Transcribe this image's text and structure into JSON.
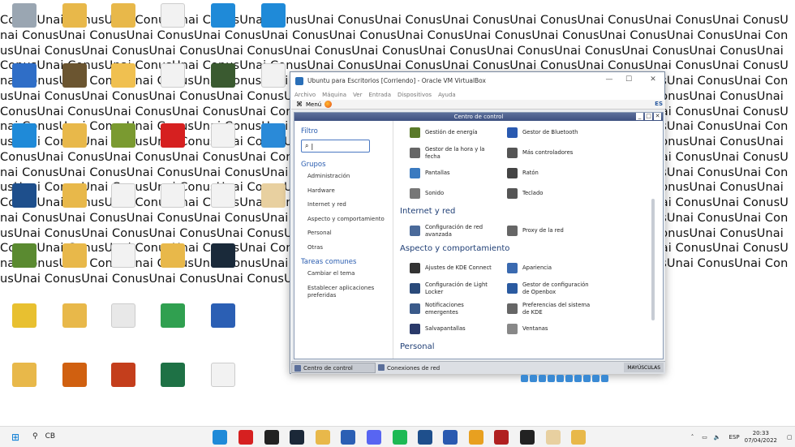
{
  "wallpaper": {
    "text": "ConusUnai ConusUnai ConusUnai ConusUnai ConusUnai ConusUnai ConusUnai ConusUnai ConusUnai ConusUnai ConusUnai ConusUnai ConusUnai ConusUnai ConusUnai ConusUnai ConusUnai ConusUnai ConusUnai ConusUnai ConusUnai ConusUnai ConusUnai ConusUnai ConusUnai ConusUnai ConusUnai ConusUnai ConusUnai ConusUnai ConusUnai ConusUnai ConusUnai ConusUnai ConusUnai ConusUnai ConusUnai ConusUnai ConusUnai ConusUnai ConusUnai ConusUnai ConusUnai ConusUnai ConusUnai ConusUnai ConusUnai ConusUnai ConusUnai ConusUnai ConusUnai ConusUnai ConusUnai ConusUnai ConusUnai ConusUnai ConusUnai ConusUnai ConusUnai ConusUnai ConusUnai ConusUnai ConusUnai ConusUnai ConusUnai ConusUnai ConusUnai ConusUnai ConusUnai ConusUnai ConusUnai ConusUnai ConusUnai ConusUnai ConusUnai ConusUnai ConusUnai ConusUnai ConusUnai ConusUnai ConusUnai ConusUnai ConusUnai ConusUnai ConusUnai ConusUnai ConusUnai ConusUnai ConusUnai ConusUnai ConusUnai ConusUnai ConusUnai ConusUnai ConusUnai ConusUnai ConusUnai ConusUnai ConusUnai ConusUnai ConusUnai ConusUnai ConusUnai ConusUnai ConusUnai ConusUnai ConusUnai ConusUnai ConusUnai ConusUnai ConusUnai ConusUnai ConusUnai ConusUnai ConusUnai ConusUnai ConusUnai ConusUnai ConusUnai ConusUnai ConusUnai ConusUnai ConusUnai ConusUnai ConusUnai ConusUnai ConusUnai ConusUnai ConusUnai ConusUnai ConusUnai ConusUnai ConusUnai ConusUnai ConusUnai ConusUnai ConusUnai ConusUnai ConusUnai ConusUnai ConusUnai ConusUnai ConusUnai ConusUnai ConusUnai ConusUnai ConusUnai ConusUnai ConusUnai ConusUnai ConusUnai ConusUnai ConusUnai ConusUnai ConusUnai ConusUnai ConusUnai ConusUnai ConusUnai ConusUnai ConusUnai ConusUnai ConusUnai ConusUnai ConusUnai ConusUnai ConusUnai ConusUnai ConusUnai ConusUnai ConusUnai ConusUnai ConusUnai ConusUnai ConusUnai ConusUnai ConusUnai ConusUnai ConusUnai ConusUnai ConusUnai ConusUnai ConusUnai ConusUnai ConusUnai ConusUnai ConusUnai ConusUnai ConusUnai ConusUnai ConusUnai ConusUnai ConusUnai ConusUnai ConusUnai ConusUnai ConusUnai ConusUnai ConusUnai ConusUnai ConusUnai ConusUnai ConusUnai ConusUnai Conus"
  },
  "desktop_icons": [
    {
      "icon": "recycle-bin-icon",
      "color": "#9aa6b2"
    },
    {
      "icon": "folder-icon",
      "color": "#e8b84a"
    },
    {
      "icon": "folder-icon",
      "color": "#e8b84a"
    },
    {
      "icon": "file-icon",
      "color": "#f2f2f2"
    },
    {
      "icon": "edge-icon",
      "color": "#1f8ad8"
    },
    {
      "icon": "edge-icon",
      "color": "#1f8ad8"
    },
    {
      "icon": "shield-icon",
      "color": "#2f6ec7"
    },
    {
      "icon": "game-icon",
      "color": "#6b5530"
    },
    {
      "icon": "app-icon",
      "color": "#f0c050"
    },
    {
      "icon": "file-icon",
      "color": "#f2f2f2"
    },
    {
      "icon": "game-icon",
      "color": "#3a5a30"
    },
    {
      "icon": "file-icon",
      "color": "#f2f2f2"
    },
    {
      "icon": "edge-icon",
      "color": "#1f8ad8"
    },
    {
      "icon": "folder-icon",
      "color": "#e8b84a"
    },
    {
      "icon": "game-icon",
      "color": "#7a9a30"
    },
    {
      "icon": "opera-icon",
      "color": "#d62020"
    },
    {
      "icon": "file-icon",
      "color": "#f2f2f2"
    },
    {
      "icon": "app-icon",
      "color": "#2a8ad8"
    },
    {
      "icon": "virtualbox-icon",
      "color": "#1e4f8c"
    },
    {
      "icon": "folder-icon",
      "color": "#e8b84a"
    },
    {
      "icon": "file-icon",
      "color": "#f2f2f2"
    },
    {
      "icon": "file-icon",
      "color": "#f2f2f2"
    },
    {
      "icon": "file-icon",
      "color": "#f2f2f2"
    },
    {
      "icon": "game-icon",
      "color": "#e8d0a0"
    },
    {
      "icon": "minecraft-icon",
      "color": "#5a8a30"
    },
    {
      "icon": "folder-icon",
      "color": "#e8b84a"
    },
    {
      "icon": "file-icon",
      "color": "#f2f2f2"
    },
    {
      "icon": "folder-icon",
      "color": "#e8b84a"
    },
    {
      "icon": "filmora-icon",
      "color": "#1a2a3a"
    },
    {
      "icon": "app-icon",
      "color": "#e8c030"
    },
    {
      "icon": "folder-icon",
      "color": "#e8b84a"
    },
    {
      "icon": "file-icon",
      "color": "#e8e8e8"
    },
    {
      "icon": "game-icon",
      "color": "#30a050"
    },
    {
      "icon": "word-icon",
      "color": "#2b5fb4"
    },
    {
      "icon": "folder-icon",
      "color": "#e8b84a"
    },
    {
      "icon": "app-icon",
      "color": "#d06010"
    },
    {
      "icon": "powerpoint-icon",
      "color": "#c43e1c"
    },
    {
      "icon": "excel-icon",
      "color": "#1e7145"
    },
    {
      "icon": "file-icon",
      "color": "#f2f2f2"
    }
  ],
  "vbox": {
    "title": "Ubuntu para Escritorios [Corriendo] - Oracle VM VirtualBox",
    "menu": [
      "Archivo",
      "Máquina",
      "Ver",
      "Entrada",
      "Dispositivos",
      "Ayuda"
    ],
    "minimize": "—",
    "maximize": "☐",
    "close": "✕"
  },
  "guest_panel": {
    "menu_label": "Menú",
    "lang": "ES"
  },
  "control_center": {
    "title": "Centro de control",
    "filter_label": "Filtro",
    "filter_value": "|",
    "groups_label": "Grupos",
    "groups": [
      "Administración",
      "Hardware",
      "Internet y red",
      "Aspecto y comportamiento",
      "Personal",
      "Otras"
    ],
    "tasks_label": "Tareas comunes",
    "tasks": [
      "Cambiar el tema",
      "Establecer aplicaciones preferidas"
    ],
    "hardware_items": [
      {
        "label": "Gestión de energía",
        "icon": "battery-icon",
        "color": "#5a7a2a"
      },
      {
        "label": "Gestor de Bluetooth",
        "icon": "bluetooth-icon",
        "color": "#2a5ab0"
      },
      {
        "label": "Gestor de la hora y la fecha",
        "icon": "clock-icon",
        "color": "#666666"
      },
      {
        "label": "Más controladores",
        "icon": "controller-icon",
        "color": "#555555"
      },
      {
        "label": "Pantallas",
        "icon": "display-icon",
        "color": "#3a7ac0"
      },
      {
        "label": "Ratón",
        "icon": "mouse-icon",
        "color": "#444444"
      },
      {
        "label": "Sonido",
        "icon": "speaker-icon",
        "color": "#777777"
      },
      {
        "label": "Teclado",
        "icon": "keyboard-icon",
        "color": "#555555"
      }
    ],
    "internet_label": "Internet y red",
    "internet_items": [
      {
        "label": "Configuración de red avanzada",
        "icon": "network-icon",
        "color": "#4a6a9a"
      },
      {
        "label": "Proxy de la red",
        "icon": "proxy-icon",
        "color": "#666666"
      }
    ],
    "aspect_label": "Aspecto y comportamiento",
    "aspect_items": [
      {
        "label": "Ajustes de KDE Connect",
        "icon": "phone-icon",
        "color": "#333333"
      },
      {
        "label": "Apariencia",
        "icon": "palette-icon",
        "color": "#3a6ab0"
      },
      {
        "label": "Configuración de Light Locker",
        "icon": "monitor-icon",
        "color": "#2a4a7a"
      },
      {
        "label": "Gestor de configuración de Openbox",
        "icon": "window-icon",
        "color": "#2a5aa0"
      },
      {
        "label": "Notificaciones emergentes",
        "icon": "notification-icon",
        "color": "#3a5a8a"
      },
      {
        "label": "Preferencias del sistema de KDE",
        "icon": "tools-icon",
        "color": "#666666"
      },
      {
        "label": "Salvapantallas",
        "icon": "screensaver-icon",
        "color": "#2a3a6a"
      },
      {
        "label": "Ventanas",
        "icon": "windows-icon",
        "color": "#888888"
      }
    ],
    "personal_label": "Personal"
  },
  "guest_taskbar": {
    "tasks": [
      "Centro de control",
      "Conexiones de red"
    ],
    "caps": "MAYÚSCULAS"
  },
  "taskbar": {
    "search": "CB",
    "apps": [
      {
        "icon": "edge-icon",
        "color": "#1f8ad8"
      },
      {
        "icon": "opera-icon",
        "color": "#d62020"
      },
      {
        "icon": "unity-icon",
        "color": "#222222"
      },
      {
        "icon": "steam-icon",
        "color": "#1b2838"
      },
      {
        "icon": "folder-icon",
        "color": "#e8b84a"
      },
      {
        "icon": "word-icon",
        "color": "#2b5fb4"
      },
      {
        "icon": "discord-icon",
        "color": "#5865f2"
      },
      {
        "icon": "spotify-icon",
        "color": "#1db954"
      },
      {
        "icon": "virtualbox-icon",
        "color": "#1e4f8c"
      },
      {
        "icon": "camera-icon",
        "color": "#2a5ab0"
      },
      {
        "icon": "chrome-icon",
        "color": "#e8a020"
      },
      {
        "icon": "app-icon",
        "color": "#b02020"
      },
      {
        "icon": "epic-icon",
        "color": "#222222"
      },
      {
        "icon": "game-icon",
        "color": "#e8d0a0"
      },
      {
        "icon": "app-icon",
        "color": "#e8b84a"
      }
    ],
    "lang": "ESP",
    "time": "20:33",
    "date": "07/04/2022"
  }
}
